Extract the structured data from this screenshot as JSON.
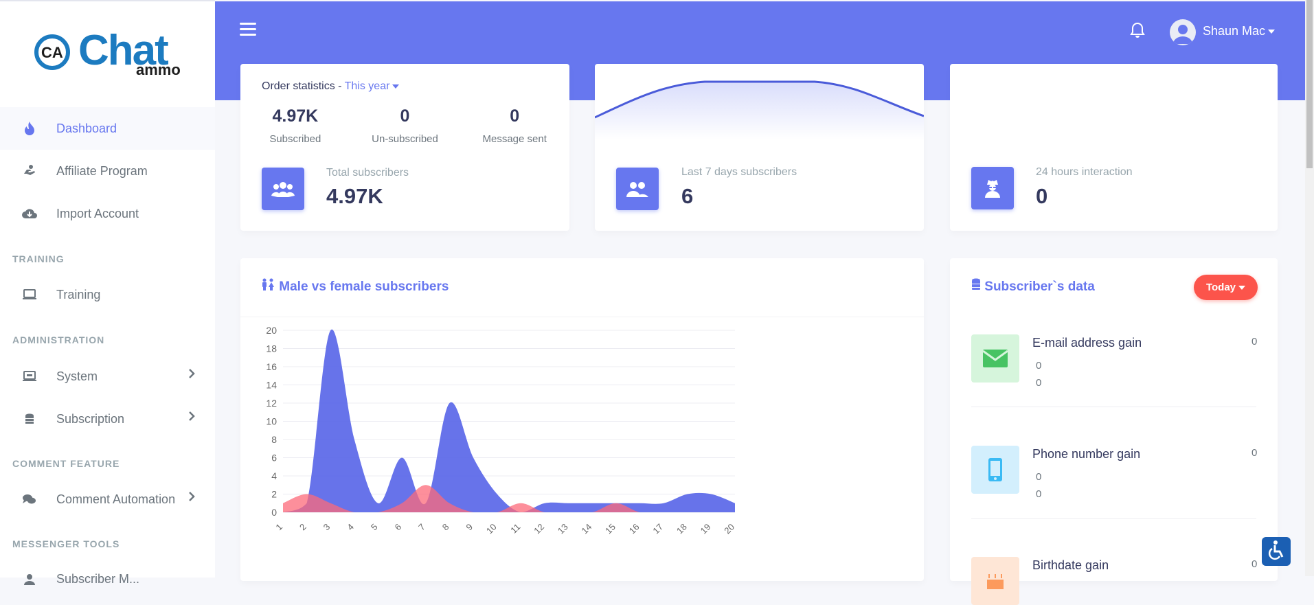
{
  "brand": {
    "logo_text": "Chat",
    "logo_sub": "ammo",
    "logo_mark": "CA"
  },
  "sidebar": {
    "items": [
      {
        "label": "Dashboard",
        "icon": "fire-icon",
        "active": true
      },
      {
        "label": "Affiliate Program",
        "icon": "hand-holding-dollar-icon"
      },
      {
        "label": "Import Account",
        "icon": "cloud-download-icon"
      }
    ],
    "sections": [
      {
        "title": "TRAINING",
        "items": [
          {
            "label": "Training",
            "icon": "laptop-icon"
          }
        ]
      },
      {
        "title": "ADMINISTRATION",
        "items": [
          {
            "label": "System",
            "icon": "server-icon",
            "has_children": true
          },
          {
            "label": "Subscription",
            "icon": "coins-icon",
            "has_children": true
          }
        ]
      },
      {
        "title": "COMMENT FEATURE",
        "items": [
          {
            "label": "Comment Automation",
            "icon": "comments-icon",
            "has_children": true
          }
        ]
      },
      {
        "title": "MESSENGER TOOLS",
        "items": [
          {
            "label": "Subscriber M...",
            "icon": "user-icon"
          }
        ]
      }
    ]
  },
  "header": {
    "user_name": "Shaun Mac",
    "notification_icon": "bell-icon",
    "menu_icon": "hamburger-icon"
  },
  "order_stats": {
    "label": "Order statistics -",
    "period": "This year",
    "metrics": [
      {
        "value": "4.97K",
        "label": "Subscribed"
      },
      {
        "value": "0",
        "label": "Un-subscribed"
      },
      {
        "value": "0",
        "label": "Message sent"
      }
    ],
    "total_label": "Total subscribers",
    "total_value": "4.97K"
  },
  "last7": {
    "label": "Last 7 days subscribers",
    "value": "6"
  },
  "interaction": {
    "label": "24 hours interaction",
    "value": "0"
  },
  "gender_chart": {
    "title": "Male vs female subscribers",
    "icon": "male-female-icon"
  },
  "subscriber_data": {
    "title": "Subscriber`s data",
    "filter": "Today",
    "icon": "database-icon",
    "items": [
      {
        "title": "E-mail address gain",
        "value": "0",
        "sub1": "0",
        "sub2": "0",
        "icon": "envelope-icon",
        "color": "#47c363"
      },
      {
        "title": "Phone number gain",
        "value": "0",
        "sub1": "0",
        "sub2": "0",
        "icon": "mobile-icon",
        "color": "#3abaf4"
      },
      {
        "title": "Birthdate gain",
        "value": "0",
        "icon": "birthday-cake-icon",
        "color": "#fc9a5c"
      }
    ]
  },
  "colors": {
    "primary": "#6777ef",
    "danger": "#fc544b",
    "male": "#5a67e8",
    "female": "#fc6a7a"
  },
  "chart_data": {
    "type": "area",
    "title": "Male vs female subscribers",
    "ylim": [
      0,
      20
    ],
    "yticks": [
      0,
      2,
      4,
      6,
      8,
      10,
      12,
      14,
      16,
      18,
      20
    ],
    "x": [
      "1",
      "2",
      "3",
      "4",
      "5",
      "6",
      "7",
      "8",
      "9",
      "10",
      "11",
      "12",
      "13",
      "14",
      "15",
      "16",
      "17",
      "18",
      "19",
      "20"
    ],
    "series": [
      {
        "name": "Male",
        "color": "#5a67e8",
        "values": [
          0,
          1,
          20,
          8,
          1,
          6,
          1,
          12,
          6,
          2,
          0,
          1,
          1,
          1,
          1,
          1,
          1,
          2,
          2,
          1
        ]
      },
      {
        "name": "Female",
        "color": "#fc6a7a",
        "values": [
          1,
          2,
          1,
          0,
          0,
          1,
          3,
          1,
          0,
          0,
          1,
          0,
          0,
          0,
          1,
          0,
          0,
          0,
          0,
          0
        ]
      }
    ],
    "grid": true
  },
  "top_wave": {
    "description_values": [
      0.28,
      0.5,
      0.85,
      1,
      1,
      1,
      0.85,
      0.5,
      0.25
    ]
  }
}
